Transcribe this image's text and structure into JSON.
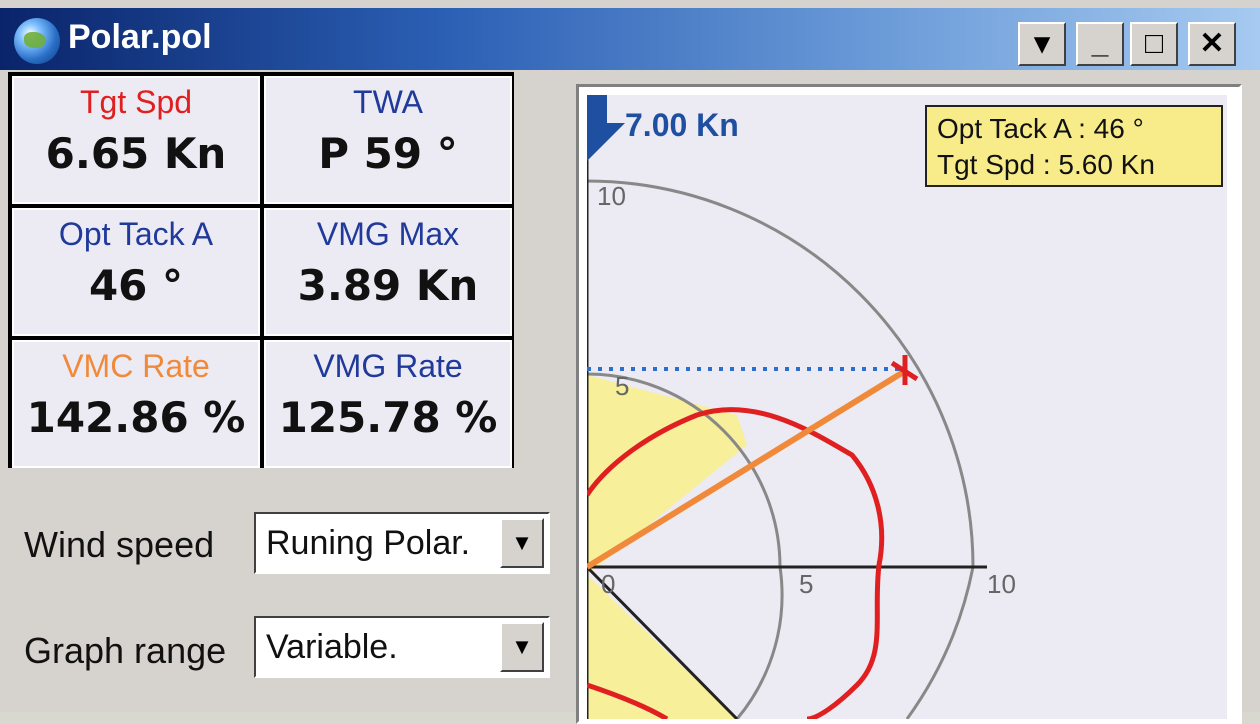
{
  "window": {
    "title": "Polar.pol",
    "buttons": {
      "menu": "▾",
      "minimize": "_",
      "maximize": "□",
      "close": "✕"
    }
  },
  "metrics": [
    {
      "label": "Tgt Spd",
      "value": "6.65 Kn",
      "color": "#e02020"
    },
    {
      "label": "TWA",
      "value": "P 59 °",
      "color": "#1f3a9a"
    },
    {
      "label": "Opt Tack A",
      "value": "46 °",
      "color": "#1f3a9a"
    },
    {
      "label": "VMG Max",
      "value": "3.89 Kn",
      "color": "#1f3a9a"
    },
    {
      "label": "VMC Rate",
      "value": "142.86 %",
      "color": "#f08a3a"
    },
    {
      "label": "VMG Rate",
      "value": "125.78 %",
      "color": "#1f3a9a"
    }
  ],
  "controls": {
    "wind_speed": {
      "label": "Wind speed",
      "value": "Runing Polar."
    },
    "graph_range": {
      "label": "Graph range",
      "value": "Variable."
    }
  },
  "plot": {
    "wind_label": "7.00 Kn",
    "tooltip": {
      "line1": "Opt Tack A : 46 °",
      "line2": "Tgt Spd : 5.60 Kn"
    },
    "radius_labels": {
      "inner": "5",
      "outer": "10"
    },
    "axis_labels": [
      "0",
      "5",
      "10"
    ]
  }
}
